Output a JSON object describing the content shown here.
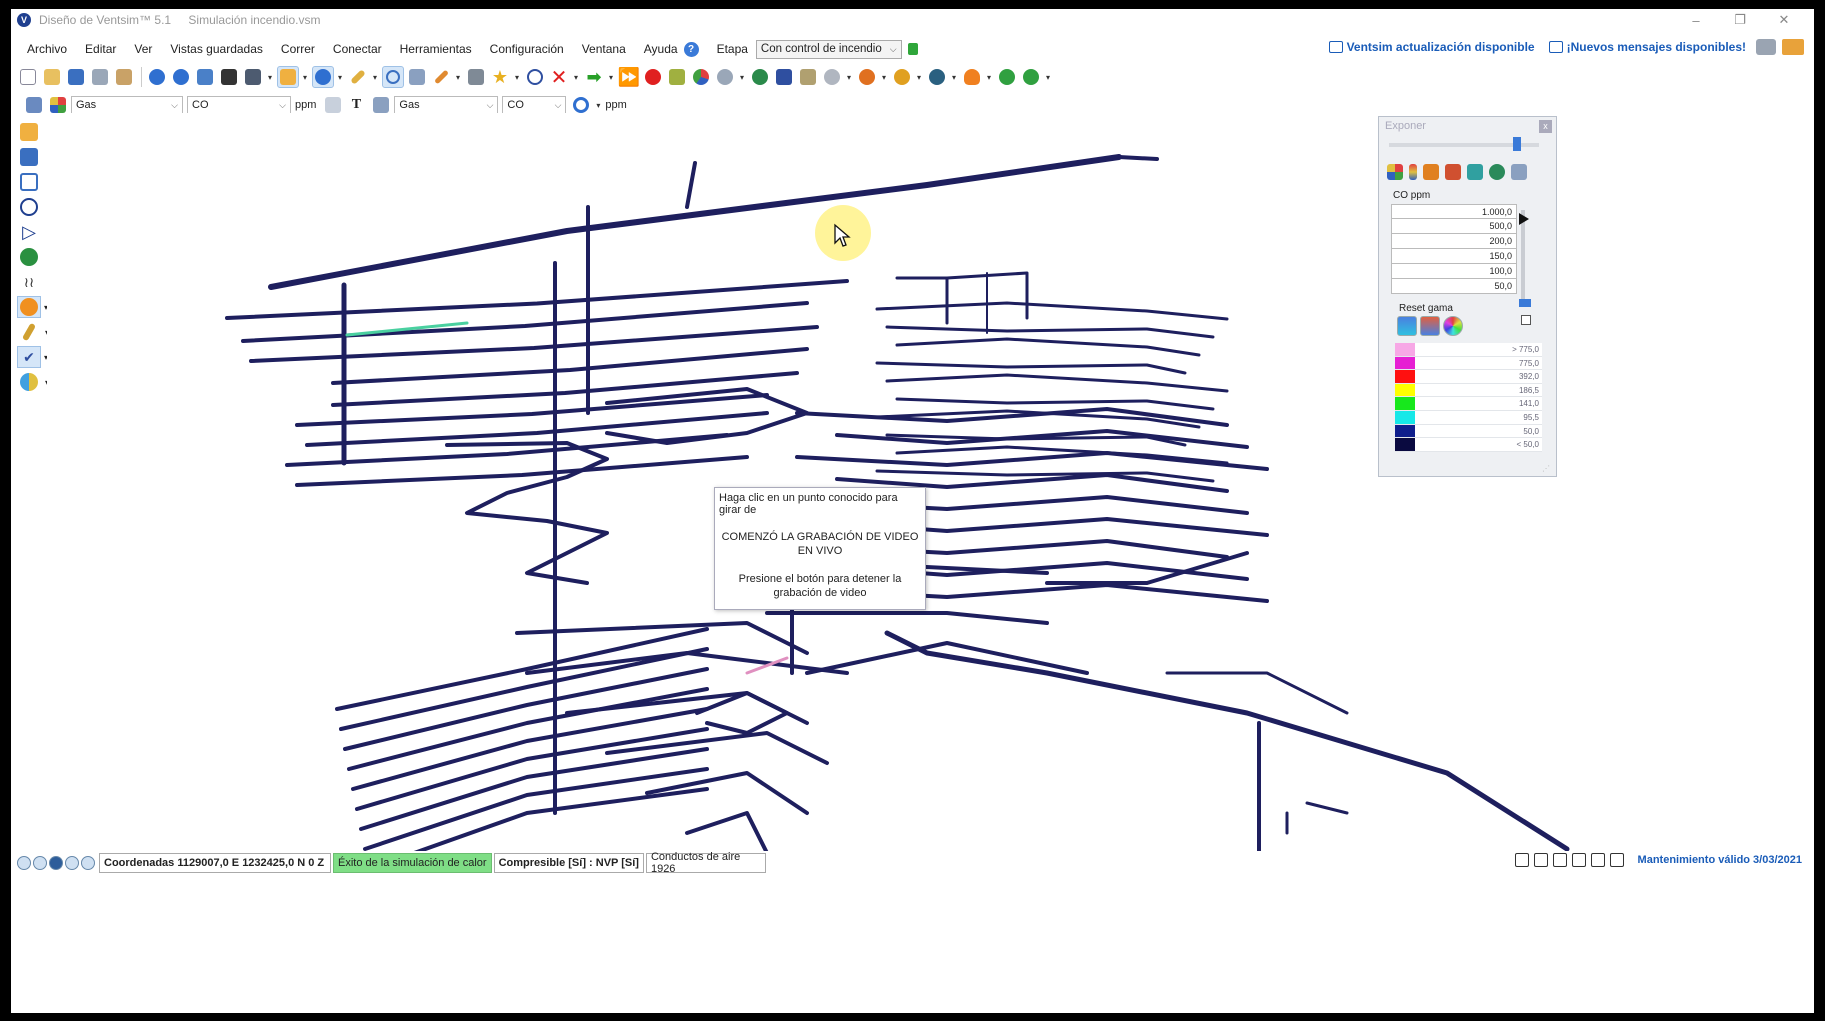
{
  "window": {
    "app_title": "Diseño de Ventsim™ 5.1",
    "file_name": "Simulación incendio.vsm",
    "controls": [
      "–",
      "❐",
      "✕"
    ]
  },
  "menu": {
    "items": [
      "Archivo",
      "Editar",
      "Ver",
      "Vistas guardadas",
      "Correr",
      "Conectar",
      "Herramientas",
      "Configuración",
      "Ventana",
      "Ayuda"
    ],
    "help_badge": "?",
    "stage_label": "Etapa",
    "stage_value": "Con control de incendio",
    "update_notice": "Ventsim actualización disponible",
    "messages_notice": "¡Nuevos mensajes disponibles!"
  },
  "toolbar2": {
    "gas_left": "Gas",
    "species_left": "CO",
    "unit_left": "ppm",
    "text_tool": "T",
    "gas_right": "Gas",
    "species_right": "CO",
    "unit_right": "ppm"
  },
  "popup": {
    "hint": "Haga clic en un punto conocido para girar de",
    "recording": "COMENZÓ LA GRABACIÓN DE VIDEO EN VIVO",
    "stop": "Presione el botón para detener la grabación de video"
  },
  "expose": {
    "title": "Exponer",
    "close": "x",
    "gas_label": "CO ppm",
    "levels": [
      "1.000,0",
      "500,0",
      "200,0",
      "150,0",
      "100,0",
      "50,0"
    ],
    "reset_label": "Reset gama",
    "scale": [
      {
        "label": "> 775,0",
        "color": "#f7a8e6"
      },
      {
        "label": "775,0",
        "color": "#e61fd3"
      },
      {
        "label": "392,0",
        "color": "#ff1010"
      },
      {
        "label": "186,5",
        "color": "#ffff00"
      },
      {
        "label": "141,0",
        "color": "#17e81c"
      },
      {
        "label": "95,5",
        "color": "#17e8e8"
      },
      {
        "label": "50,0",
        "color": "#0f1e8c"
      },
      {
        "label": "< 50,0",
        "color": "#0a0a40"
      }
    ]
  },
  "status": {
    "coords": "Coordenadas 1129007,0 E   1232425,0 N   0 Z",
    "heat_sim": "Éxito de la simulación de calor",
    "compressible": "Compresible [Sí] : NVP [Sí]",
    "ducts": "Conductos de aire 1926",
    "maintenance": "Mantenimiento válido 3/03/2021"
  },
  "colors": {
    "airway": "#1e1f5e",
    "accent": "#1a5cb8",
    "status_green": "#7fde86"
  }
}
